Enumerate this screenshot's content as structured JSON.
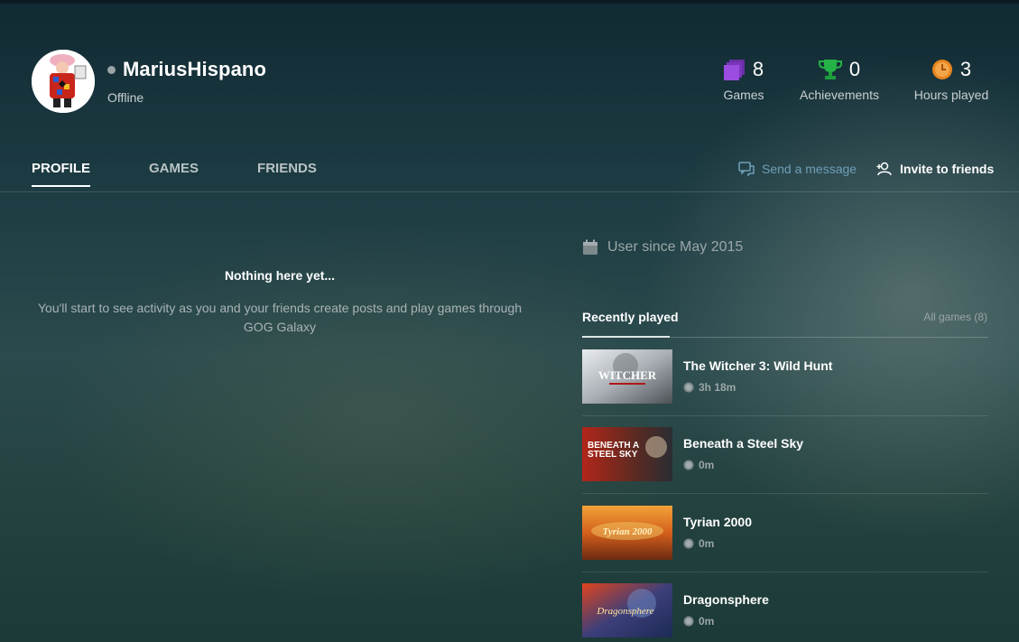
{
  "profile": {
    "username": "MariusHispano",
    "status": "Offline",
    "status_color": "#9aa3a5"
  },
  "stats": {
    "games": {
      "value": "8",
      "label": "Games",
      "icon": "games-icon",
      "color": "#8b3fd0"
    },
    "achievements": {
      "value": "0",
      "label": "Achievements",
      "icon": "trophy-icon",
      "color": "#2fb84a"
    },
    "hours": {
      "value": "3",
      "label": "Hours played",
      "icon": "clock-icon",
      "color": "#f0952a"
    }
  },
  "tabs": [
    {
      "label": "PROFILE",
      "active": true
    },
    {
      "label": "GAMES",
      "active": false
    },
    {
      "label": "FRIENDS",
      "active": false
    }
  ],
  "actions": {
    "send_message": "Send a message",
    "invite": "Invite to friends"
  },
  "feed": {
    "empty_title": "Nothing here yet...",
    "empty_text": "You'll start to see activity as you and your friends create posts and play games through GOG Galaxy"
  },
  "sidebar": {
    "user_since": "User since May 2015",
    "recently_played_title": "Recently played",
    "all_games_link": "All games (8)",
    "games": [
      {
        "name": "The Witcher 3: Wild Hunt",
        "time": "3h 18m",
        "cover_text": "WITCHER"
      },
      {
        "name": "Beneath a Steel Sky",
        "time": "0m",
        "cover_text": "BENEATH A STEEL SKY"
      },
      {
        "name": "Tyrian 2000",
        "time": "0m",
        "cover_text": "Tyrian 2000"
      },
      {
        "name": "Dragonsphere",
        "time": "0m",
        "cover_text": "Dragonsphere"
      }
    ]
  }
}
